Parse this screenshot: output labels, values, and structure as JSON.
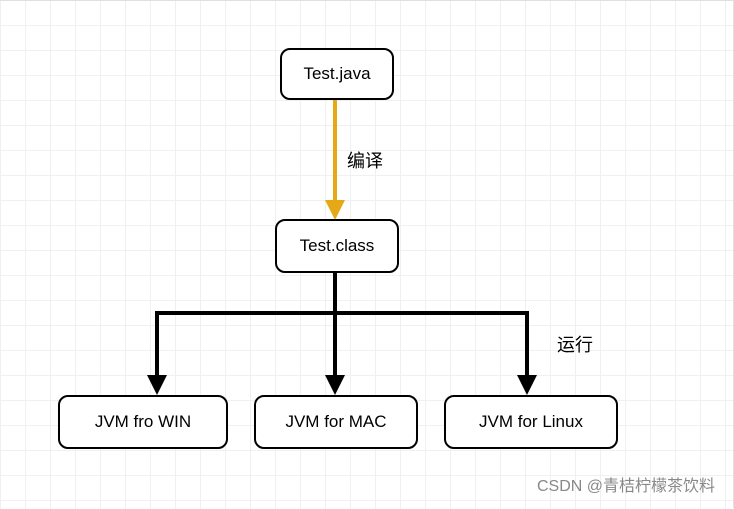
{
  "nodes": {
    "source": "Test.java",
    "compiled": "Test.class",
    "jvm_win": "JVM fro WIN",
    "jvm_mac": "JVM for MAC",
    "jvm_linux": "JVM for Linux"
  },
  "labels": {
    "compile": "编译",
    "run": "运行"
  },
  "watermark": "CSDN @青桔柠檬茶饮料",
  "chart_data": {
    "type": "diagram",
    "title": "",
    "description": "Java compilation and cross-platform JVM execution",
    "nodes": [
      {
        "id": "source",
        "label": "Test.java"
      },
      {
        "id": "compiled",
        "label": "Test.class"
      },
      {
        "id": "jvm_win",
        "label": "JVM fro WIN"
      },
      {
        "id": "jvm_mac",
        "label": "JVM for MAC"
      },
      {
        "id": "jvm_linux",
        "label": "JVM for Linux"
      }
    ],
    "edges": [
      {
        "from": "source",
        "to": "compiled",
        "label": "编译",
        "color": "#e6a817"
      },
      {
        "from": "compiled",
        "to": "jvm_win",
        "label": "运行",
        "color": "#000000"
      },
      {
        "from": "compiled",
        "to": "jvm_mac",
        "label": "运行",
        "color": "#000000"
      },
      {
        "from": "compiled",
        "to": "jvm_linux",
        "label": "运行",
        "color": "#000000"
      }
    ]
  }
}
